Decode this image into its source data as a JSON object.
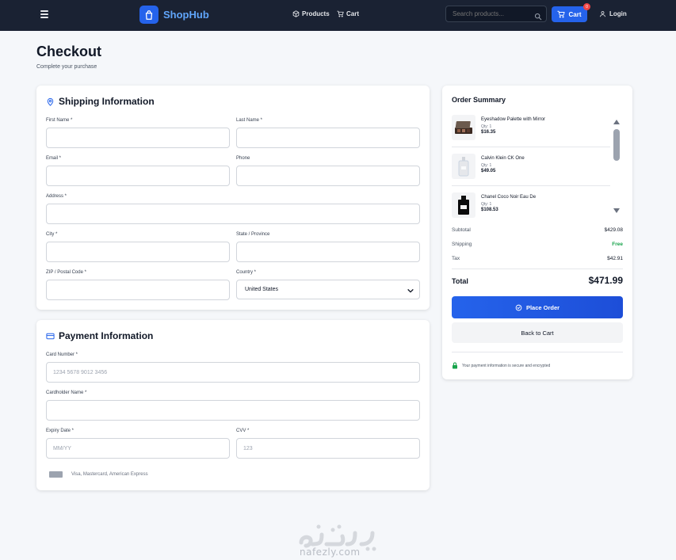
{
  "navbar": {
    "brand": "ShopHub",
    "products_label": "Products",
    "cart_link_label": "Cart",
    "search_placeholder": "Search products...",
    "cart_button_label": "Cart",
    "cart_count": "0",
    "login_label": "Login"
  },
  "page": {
    "title": "Checkout",
    "subtitle": "Complete your purchase"
  },
  "shipping": {
    "title": "Shipping Information",
    "first_name_label": "First Name *",
    "last_name_label": "Last Name *",
    "email_label": "Email *",
    "phone_label": "Phone",
    "address_label": "Address *",
    "city_label": "City *",
    "state_label": "State / Province",
    "zip_label": "ZIP / Postal Code *",
    "country_label": "Country *",
    "country_value": "United States"
  },
  "payment": {
    "title": "Payment Information",
    "card_number_label": "Card Number *",
    "card_number_placeholder": "1234 5678 9012 3456",
    "cardholder_label": "Cardholder Name *",
    "expiry_label": "Expiry Date *",
    "expiry_placeholder": "MM/YY",
    "cvv_label": "CVV *",
    "cvv_placeholder": "123",
    "accepted_cards": "Visa, Mastercard, American Express"
  },
  "summary": {
    "title": "Order Summary",
    "items": [
      {
        "name": "Eyeshadow Palette with Mirror",
        "qty": "Qty: 1",
        "price": "$16.35"
      },
      {
        "name": "Calvin Klein CK One",
        "qty": "Qty: 1",
        "price": "$49.05"
      },
      {
        "name": "Chanel Coco Noir Eau De",
        "qty": "Qty: 1",
        "price": "$108.53"
      }
    ],
    "subtotal_label": "Subtotal",
    "subtotal_value": "$429.08",
    "shipping_label": "Shipping",
    "shipping_value": "Free",
    "tax_label": "Tax",
    "tax_value": "$42.91",
    "total_label": "Total",
    "total_value": "$471.99",
    "place_order_label": "Place Order",
    "back_label": "Back to Cart",
    "secure_note": "Your payment information is secure and encrypted"
  },
  "watermark": {
    "latin": "nafezly.com"
  },
  "colors": {
    "navbar_bg": "#1a2233",
    "accent": "#2563eb",
    "free_green": "#16a34a",
    "badge_red": "#ef4444"
  },
  "icons": {
    "menu": "hamburger-icon",
    "brand": "shopping-bag-icon",
    "products": "box-icon",
    "cart": "cart-icon",
    "search": "search-icon",
    "login": "user-icon",
    "shipping": "map-pin-icon",
    "payment": "credit-card-icon",
    "place_order": "check-circle-icon",
    "secure": "lock-icon"
  }
}
